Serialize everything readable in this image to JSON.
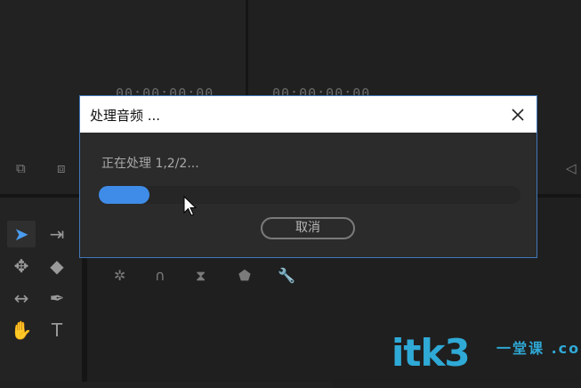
{
  "background": {
    "source_timecode": "00:00:00:00",
    "program_timecode": "00:00:00:00"
  },
  "dialog": {
    "title": "处理音频 ...",
    "status_text": "正在处理 1,2/2...",
    "progress_fraction": 0.12,
    "cancel_label": "取消",
    "accent_color": "#3f8ce8"
  },
  "watermark": {
    "text": "itk3",
    "suffix": "一堂课 .com"
  }
}
